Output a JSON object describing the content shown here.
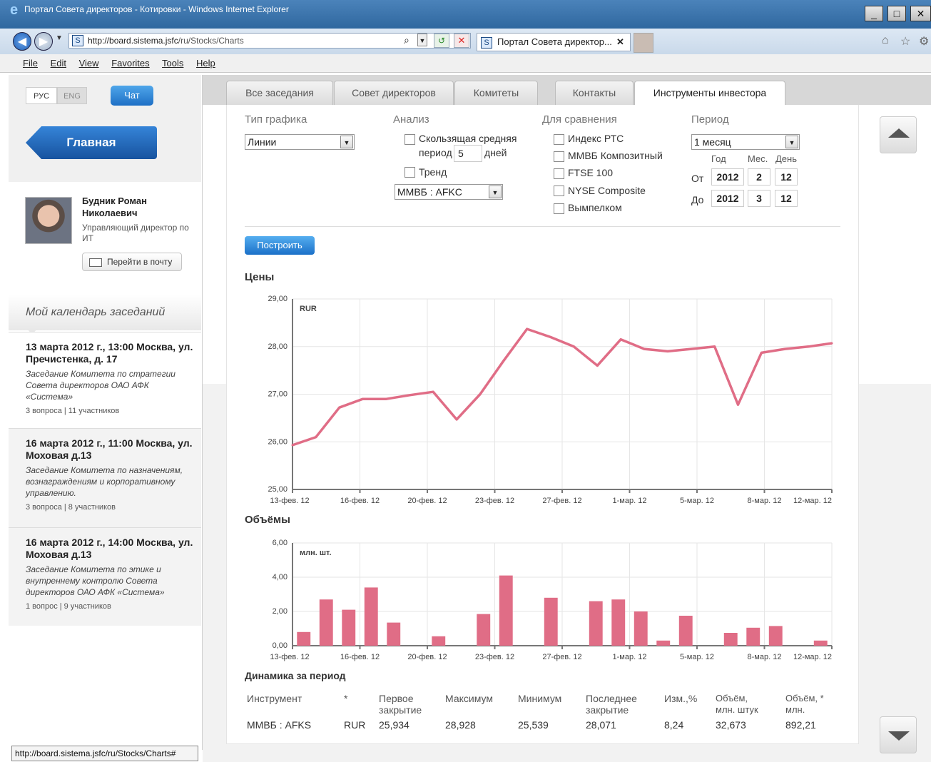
{
  "browser": {
    "window_title": "Портал Совета директоров - Котировки - Windows Internet Explorer",
    "url_host": "http://board.sistema.jsfc",
    "url_path": "/ru/Stocks/Charts",
    "tab_title": "Портал Совета директор...",
    "menu": [
      "File",
      "Edit",
      "View",
      "Favorites",
      "Tools",
      "Help"
    ],
    "status_url": "http://board.sistema.jsfc/ru/Stocks/Charts#"
  },
  "sidebar": {
    "lang_ru": "РУС",
    "lang_en": "ENG",
    "chat": "Чат",
    "home": "Главная",
    "user_name": "Будник Роман Николаевич",
    "user_role": "Управляющий директор по ИТ",
    "mail_button": "Перейти в почту",
    "calendar_title": "Мой календарь заседаний",
    "events": [
      {
        "title": "13 марта 2012 г., 13:00 Москва, ул. Пречистенка, д. 17",
        "desc": "Заседание Комитета по стратегии Совета директоров ОАО АФК «Система»",
        "meta": "3 вопроса   |   11 участников"
      },
      {
        "title": "16 марта 2012 г., 11:00 Москва, ул. Моховая д.13",
        "desc": "Заседание Комитета по назначениям, вознаграждениям и корпоративному управлению.",
        "meta": "3 вопроса   |   8 участников"
      },
      {
        "title": "16 марта 2012 г., 14:00 Москва, ул. Моховая д.13",
        "desc": "Заседание Комитета по этике и внутреннему контролю Совета директоров ОАО АФК «Система»",
        "meta": "1 вопрос   |   9 участников"
      }
    ]
  },
  "tabs": [
    "Все заседания",
    "Совет директоров",
    "Комитеты",
    "Контакты",
    "Инструменты инвестора"
  ],
  "form": {
    "chart_type_label": "Тип графика",
    "chart_type_value": "Линии",
    "analysis_label": "Анализ",
    "moving_avg_label": "Скользящая средняя",
    "period_label": "период",
    "period_value": "5",
    "days_label": "дней",
    "trend_label": "Тренд",
    "instrument_value": "ММВБ : AFKC",
    "compare_label": "Для сравнения",
    "compare_items": [
      "Индекс РТС",
      "ММВБ Композитный",
      "FTSE 100",
      "NYSE Composite",
      "Вымпелком"
    ],
    "period_section_label": "Период",
    "period_select": "1 месяц",
    "year_label": "Год",
    "month_label": "Мес.",
    "day_label": "День",
    "from_label": "От",
    "from_year": "2012",
    "from_month": "2",
    "from_day": "12",
    "to_label": "До",
    "to_year": "2012",
    "to_month": "3",
    "to_day": "12",
    "build_button": "Построить"
  },
  "prices_title": "Цены",
  "volumes_title": "Объёмы",
  "dynamics_title": "Динамика за период",
  "chart_data": [
    {
      "type": "line",
      "unit_label": "RUR",
      "ylim": [
        25,
        29
      ],
      "y_ticks": [
        "25,00",
        "26,00",
        "27,00",
        "28,00",
        "29,00"
      ],
      "x_ticks": [
        "13-фев. 12",
        "16-фев. 12",
        "20-фев. 12",
        "23-фев. 12",
        "27-фев. 12",
        "1-мар. 12",
        "5-мар. 12",
        "8-мар. 12",
        "12-мар. 12"
      ],
      "series": [
        {
          "color": "#e06d86",
          "values": [
            25.93,
            26.1,
            26.72,
            26.9,
            26.9,
            26.98,
            27.05,
            26.47,
            27.0,
            27.7,
            28.37,
            28.2,
            28.0,
            27.6,
            28.15,
            27.95,
            27.9,
            27.95,
            28.0,
            26.78,
            27.87,
            27.95,
            28.0,
            28.07
          ]
        }
      ]
    },
    {
      "type": "bar",
      "unit_label": "млн. шт.",
      "ylim": [
        0,
        6
      ],
      "y_ticks": [
        "0,00",
        "2,00",
        "4,00",
        "6,00"
      ],
      "x_ticks": [
        "13-фев. 12",
        "16-фев. 12",
        "20-фев. 12",
        "23-фев. 12",
        "27-фев. 12",
        "1-мар. 12",
        "5-мар. 12",
        "8-мар. 12",
        "12-мар. 12"
      ],
      "series": [
        {
          "color": "#e06d86",
          "values": [
            0.8,
            2.7,
            2.1,
            3.4,
            1.35,
            0,
            0.55,
            0,
            1.85,
            4.1,
            0,
            2.8,
            0,
            2.6,
            2.7,
            2.0,
            0.3,
            1.75,
            0,
            0.75,
            1.05,
            1.15,
            0,
            0.3
          ]
        }
      ]
    }
  ],
  "dynamics_table": {
    "headers": [
      "Инструмент",
      "*",
      "Первое закрытие",
      "Максимум",
      "Минимум",
      "Последнее закрытие",
      "Изм.,%",
      "Объём, млн. штук",
      "Объём, * млн."
    ],
    "row": [
      "ММВБ : AFKS",
      "RUR",
      "25,934",
      "28,928",
      "25,539",
      "28,071",
      "8,24",
      "32,673",
      "892,21"
    ]
  }
}
